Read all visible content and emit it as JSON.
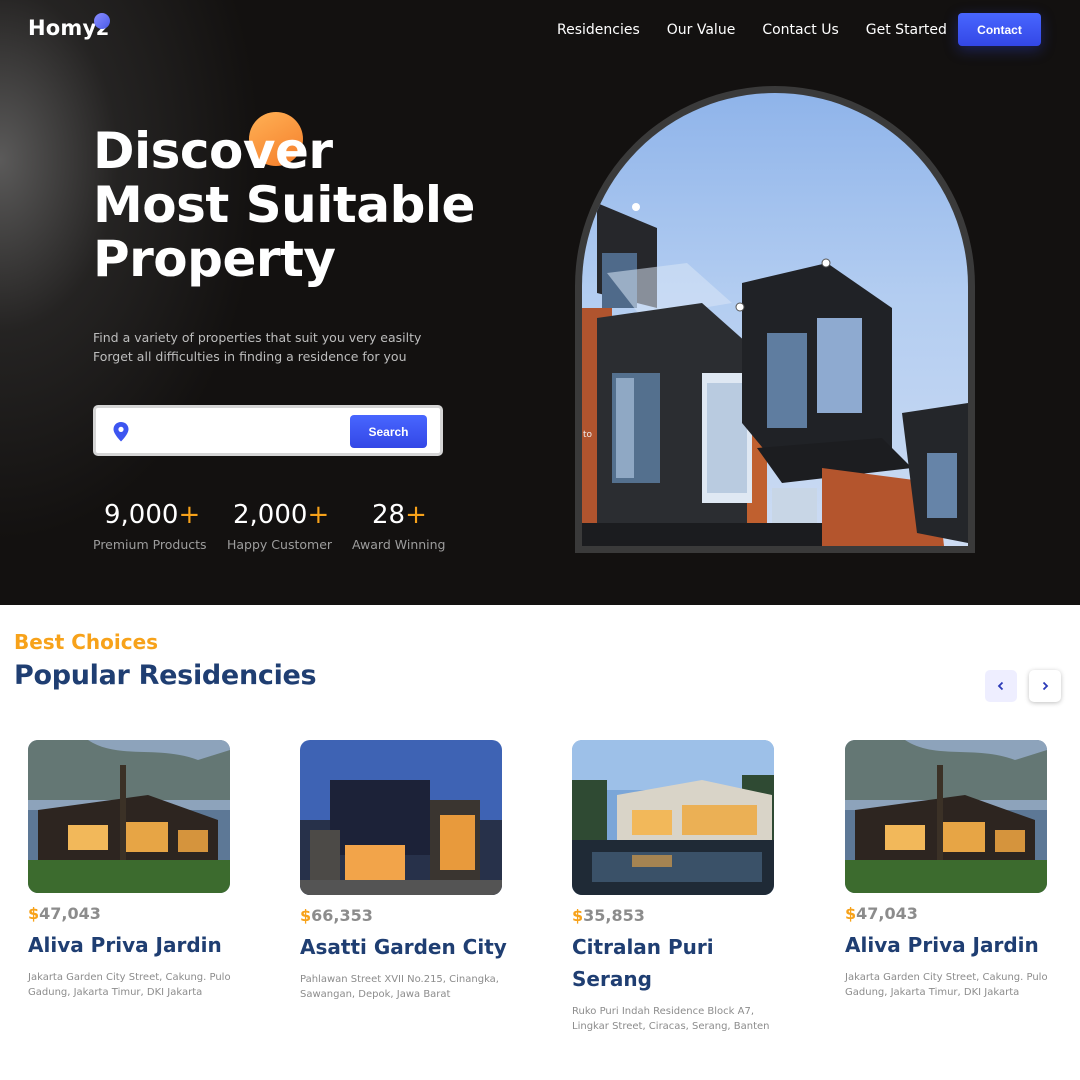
{
  "app": {
    "logo": "Homyz"
  },
  "nav": {
    "items": [
      "Residencies",
      "Our Value",
      "Contact Us",
      "Get Started"
    ],
    "cta": "Contact"
  },
  "hero": {
    "headline": [
      "Discover",
      "Most Suitable",
      "Property"
    ],
    "subtext": [
      "Find a variety of properties that suit you very easilty",
      "Forget all difficulties in finding a residence for you"
    ],
    "search": {
      "placeholder": "",
      "button": "Search"
    },
    "stats": [
      {
        "number": "9,000",
        "plus": "+",
        "label": "Premium Products"
      },
      {
        "number": "2,000",
        "plus": "+",
        "label": "Happy Customer"
      },
      {
        "number": "28",
        "plus": "+",
        "label": "Award Winning"
      }
    ],
    "image_stray_text": "to"
  },
  "residencies": {
    "eyebrow": "Best Choices",
    "title": "Popular Residencies",
    "cards": [
      {
        "currency": "$",
        "price": "47,043",
        "name": "Aliva Priva Jardin",
        "address": "Jakarta Garden City Street, Cakung. Pulo Gadung, Jakarta Timur, DKI Jakarta"
      },
      {
        "currency": "$",
        "price": "66,353",
        "name": "Asatti Garden City",
        "address": "Pahlawan Street XVII No.215, Cinangka, Sawangan, Depok, Jawa Barat"
      },
      {
        "currency": "$",
        "price": "35,853",
        "name": "Citralan Puri Serang",
        "address": "Ruko Puri Indah Residence Block A7, Lingkar Street, Ciracas, Serang, Banten"
      },
      {
        "currency": "$",
        "price": "47,043",
        "name": "Aliva Priva Jardin",
        "address": "Jakarta Garden City Street, Cakung. Pulo Gadung, Jakarta Timur, DKI Jakarta"
      }
    ]
  },
  "colors": {
    "accent_blue": "#3d55f0",
    "accent_orange": "#f7a21a",
    "title_navy": "#1f3e72",
    "hero_bg": "#131110"
  },
  "icons": [
    "location-pin-icon",
    "chevron-left-icon",
    "chevron-right-icon"
  ]
}
